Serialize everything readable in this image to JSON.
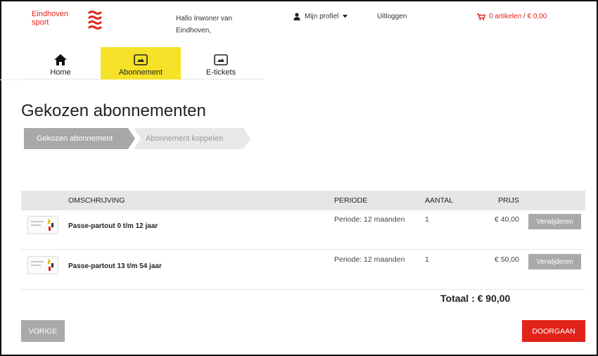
{
  "brand": {
    "logo_line1": "Eindhoven",
    "logo_line2": "sport",
    "accent": "#e2231a"
  },
  "header": {
    "greeting": "Hallo Inwoner van Eindhoven,",
    "profile_label": "Mijn profiel",
    "profile_icon": "user-icon",
    "logout_label": "Uitloggen",
    "cart_label": "0 artikelen / € 0,00",
    "cart_icon": "cart-icon"
  },
  "nav": {
    "items": [
      {
        "label": "Home",
        "icon": "home-icon",
        "active": false
      },
      {
        "label": "Abonnement",
        "icon": "card-icon",
        "active": true
      },
      {
        "label": "E-tickets",
        "icon": "ticket-icon",
        "active": false
      }
    ],
    "active_color": "#f7e22a"
  },
  "page": {
    "title": "Gekozen abonnementen"
  },
  "steps": [
    {
      "label": "Gekozen abonnement",
      "state": "current"
    },
    {
      "label": "Abonnement koppelen",
      "state": "upcoming"
    }
  ],
  "table": {
    "headers": {
      "description": "OMSCHRIJVING",
      "period": "PERIODE",
      "quantity": "AANTAL",
      "price": "PRIJS"
    },
    "rows": [
      {
        "description": "Passe-partout 0 t/m 12 jaar",
        "period": "Periode: 12 maanden",
        "quantity": "1",
        "price": "€ 40,00",
        "remove_label": "Verwijderen"
      },
      {
        "description": "Passe-partout 13 t/m 54 jaar",
        "period": "Periode: 12 maanden",
        "quantity": "1",
        "price": "€ 50,00",
        "remove_label": "Verwijderen"
      }
    ],
    "total": "Totaal : € 90,00"
  },
  "actions": {
    "prev_label": "VORIGE",
    "next_label": "DOORGAAN"
  }
}
